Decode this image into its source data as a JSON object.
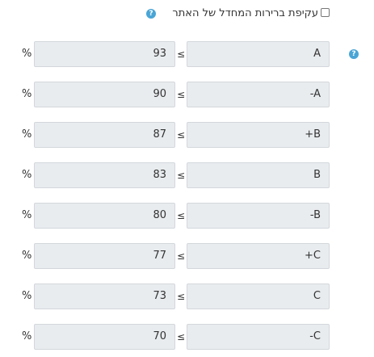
{
  "override": {
    "label": "עקיפת ברירות המחדל של האתר",
    "checked": false,
    "help_icon_glyph": "?"
  },
  "rows_help_icon_glyph": "?",
  "grade_rows": [
    {
      "percent_sign": "%",
      "value": "93",
      "operator": "≤",
      "letter": "A"
    },
    {
      "percent_sign": "%",
      "value": "90",
      "operator": "≤",
      "letter": "-A"
    },
    {
      "percent_sign": "%",
      "value": "87",
      "operator": "≤",
      "letter": "+B"
    },
    {
      "percent_sign": "%",
      "value": "83",
      "operator": "≤",
      "letter": "B"
    },
    {
      "percent_sign": "%",
      "value": "80",
      "operator": "≤",
      "letter": "-B"
    },
    {
      "percent_sign": "%",
      "value": "77",
      "operator": "≤",
      "letter": "+C"
    },
    {
      "percent_sign": "%",
      "value": "73",
      "operator": "≤",
      "letter": "C"
    },
    {
      "percent_sign": "%",
      "value": "70",
      "operator": "≤",
      "letter": "-C"
    }
  ],
  "colors": {
    "field_background": "#e9ecef",
    "help_icon": "#4aa5d6"
  }
}
